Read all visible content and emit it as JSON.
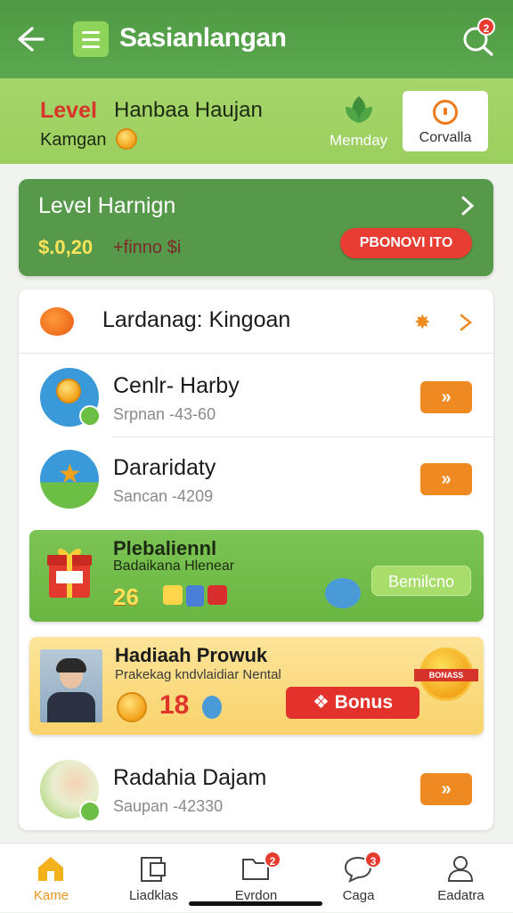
{
  "appbar": {
    "title": "Sasianlangan",
    "search_badge": "2"
  },
  "level_strip": {
    "level_label": "Level",
    "name": "Hanbaa Haujan",
    "sub_label": "Kamgan",
    "monday_label": "Memday",
    "convert_label": "Corvalla"
  },
  "level_card": {
    "title": "Level Harnign",
    "amount": "$.0,20",
    "extra": "+finno $i",
    "promo_button": "PBONOVI ITO"
  },
  "panel": {
    "header_title": "Lardanag: Kingoan",
    "rows": [
      {
        "title": "Cenlr- Harby",
        "subtitle": "Srpnan -43-60",
        "action": "»"
      },
      {
        "title": "Dararidaty",
        "subtitle": "Sancan -4209",
        "action": "»"
      },
      {
        "title": "Radahia Dajam",
        "subtitle": "Saupan -42330",
        "action": "»"
      }
    ]
  },
  "promo_green": {
    "title": "Plebaliennl",
    "subtitle": "Badaikana Hlenear",
    "numbers": "26",
    "button": "Bemilcno"
  },
  "promo_yellow": {
    "title": "Hadiaah Prowuk",
    "subtitle": "Prakekag kndvlaidiar Nental",
    "number": "18",
    "bonus_button": "Bonus",
    "medal_label": "BONASS"
  },
  "bottom_nav": {
    "items": [
      {
        "label": "Kame",
        "badge": ""
      },
      {
        "label": "Liadklas",
        "badge": ""
      },
      {
        "label": "Evrdon",
        "badge": "2"
      },
      {
        "label": "Caga",
        "badge": "3"
      },
      {
        "label": "Eadatra",
        "badge": ""
      }
    ]
  },
  "colors": {
    "appbar_green": "#4f9a44",
    "strip_green": "#a6d56a",
    "accent_orange": "#ef8a22",
    "alert_red": "#e83d33"
  }
}
